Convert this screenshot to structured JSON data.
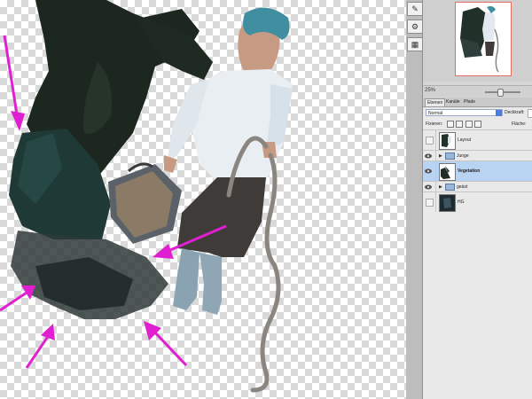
{
  "navigator": {
    "zoom": "25%"
  },
  "layers_panel": {
    "tabs": [
      {
        "label": "Ebenen",
        "active": true
      },
      {
        "label": "Kanäle",
        "active": false
      },
      {
        "label": "Pfade",
        "active": false
      }
    ],
    "blend_mode": "Normal",
    "opacity_label": "Deckkraft:",
    "fix_label": "Fixieren:",
    "fill_label": "Fläche:",
    "layers": [
      {
        "name": "Layout",
        "type": "layer",
        "visible": false,
        "selected": false
      },
      {
        "name": "Junge",
        "type": "group",
        "visible": true,
        "selected": false
      },
      {
        "name": "Vegetation",
        "type": "layer",
        "visible": true,
        "selected": true
      },
      {
        "name": "geäst",
        "type": "group",
        "visible": true,
        "selected": false
      },
      {
        "name": "HG",
        "type": "layer",
        "visible": false,
        "selected": false
      }
    ]
  },
  "colors": {
    "arrow_accent": "#e020d0",
    "selection": "#b9d3f3"
  }
}
